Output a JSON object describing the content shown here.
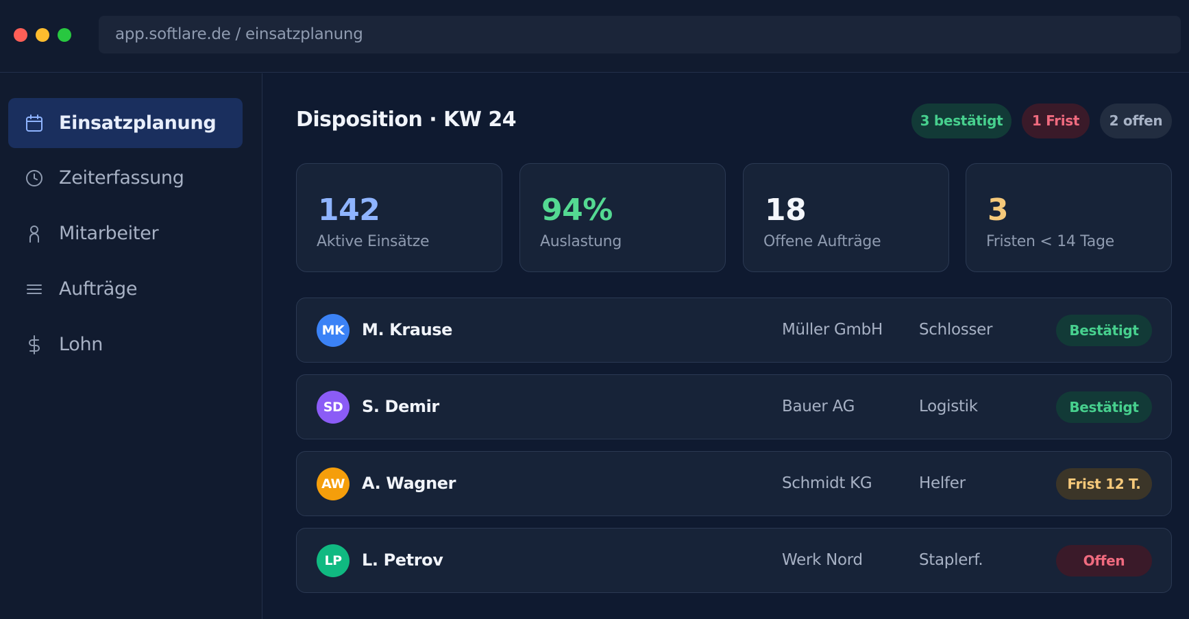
{
  "browser": {
    "url": "app.softlare.de / einsatzplanung"
  },
  "sidebar": {
    "items": [
      {
        "label": "Einsatzplanung",
        "icon": "calendar-icon",
        "active": true
      },
      {
        "label": "Zeiterfassung",
        "icon": "clock-icon",
        "active": false
      },
      {
        "label": "Mitarbeiter",
        "icon": "person-icon",
        "active": false
      },
      {
        "label": "Aufträge",
        "icon": "list-icon",
        "active": false
      },
      {
        "label": "Lohn",
        "icon": "dollar-icon",
        "active": false
      }
    ]
  },
  "header": {
    "title": "Disposition · KW 24",
    "chips": [
      {
        "label": "3 bestätigt",
        "color": "#47d08e"
      },
      {
        "label": "1 Frist",
        "color": "#f06b7f"
      },
      {
        "label": "2 offen",
        "color": "#a8b3c6"
      }
    ]
  },
  "stats": [
    {
      "value": "142",
      "label": "Aktive Einsätze",
      "color": "#8fb4ff"
    },
    {
      "value": "94%",
      "label": "Auslastung",
      "color": "#54d992"
    },
    {
      "value": "18",
      "label": "Offene Aufträge",
      "color": "#f4f6fb"
    },
    {
      "value": "3",
      "label": "Fristen < 14 Tage",
      "color": "#f6c97a"
    }
  ],
  "assignments": [
    {
      "initials": "MK",
      "avatar_color": "#3b82f6",
      "name": "M. Krause",
      "client": "Müller GmbH",
      "role": "Schlosser",
      "status": "Bestätigt",
      "status_type": "ok"
    },
    {
      "initials": "SD",
      "avatar_color": "#8b5cf6",
      "name": "S. Demir",
      "client": "Bauer AG",
      "role": "Logistik",
      "status": "Bestätigt",
      "status_type": "ok"
    },
    {
      "initials": "AW",
      "avatar_color": "#f59e0b",
      "name": "A. Wagner",
      "client": "Schmidt KG",
      "role": "Helfer",
      "status": "Frist 12 T.",
      "status_type": "warn"
    },
    {
      "initials": "LP",
      "avatar_color": "#10b981",
      "name": "L. Petrov",
      "client": "Werk Nord",
      "role": "Staplerf.",
      "status": "Offen",
      "status_type": "open"
    }
  ]
}
